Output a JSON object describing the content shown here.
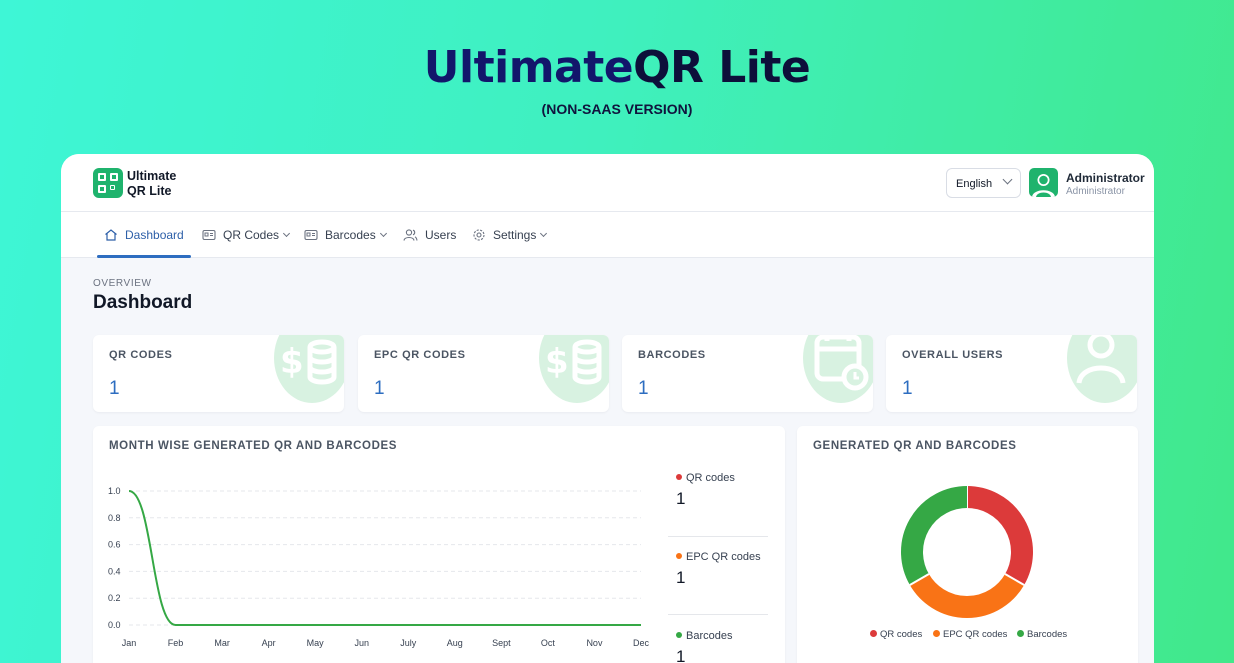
{
  "hero": {
    "title_part1": "Ultimate",
    "title_part2": "QR Lite",
    "subtitle": "(NON-SAAS VERSION)"
  },
  "app": {
    "logo": {
      "line1": "Ultimate",
      "line2": "QR Lite"
    },
    "language": {
      "selected": "English"
    },
    "user": {
      "name": "Administrator",
      "role": "Administrator"
    },
    "nav": [
      {
        "label": "Dashboard",
        "icon": "home-icon",
        "active": true
      },
      {
        "label": "QR Codes",
        "icon": "qr-card-icon",
        "dropdown": true
      },
      {
        "label": "Barcodes",
        "icon": "barcode-card-icon",
        "dropdown": true
      },
      {
        "label": "Users",
        "icon": "users-icon"
      },
      {
        "label": "Settings",
        "icon": "gear-icon",
        "dropdown": true
      }
    ],
    "overview_label": "OVERVIEW",
    "page_title": "Dashboard",
    "stats": [
      {
        "label": "QR CODES",
        "value": "1",
        "icon": "money-stack-icon"
      },
      {
        "label": "EPC QR CODES",
        "value": "1",
        "icon": "money-stack-icon"
      },
      {
        "label": "BARCODES",
        "value": "1",
        "icon": "calendar-clock-icon"
      },
      {
        "label": "OVERALL USERS",
        "value": "1",
        "icon": "user-icon"
      }
    ],
    "line_panel": {
      "title": "MONTH WISE GENERATED QR AND BARCODES",
      "legend": [
        {
          "label": "QR codes",
          "value": "1",
          "color": "#dc3a3a"
        },
        {
          "label": "EPC QR codes",
          "value": "1",
          "color": "#f97316"
        },
        {
          "label": "Barcodes",
          "value": "1",
          "color": "#35a845"
        }
      ]
    },
    "donut_panel": {
      "title": "GENERATED QR AND BARCODES"
    }
  },
  "chart_data": [
    {
      "type": "line",
      "x": [
        "Jan",
        "Feb",
        "Mar",
        "Apr",
        "May",
        "Jun",
        "July",
        "Aug",
        "Sept",
        "Oct",
        "Nov",
        "Dec"
      ],
      "yticks": [
        "1.0",
        "0.8",
        "0.6",
        "0.4",
        "0.2",
        "0.0"
      ],
      "ylim": [
        0,
        1
      ],
      "grid": true,
      "series": [
        {
          "name": "Barcodes",
          "color": "#35a845",
          "values": [
            1,
            0,
            0,
            0,
            0,
            0,
            0,
            0,
            0,
            0,
            0,
            0
          ]
        }
      ]
    },
    {
      "type": "pie",
      "categories": [
        "QR codes",
        "EPC QR codes",
        "Barcodes"
      ],
      "values": [
        1,
        1,
        1
      ],
      "colors": [
        "#dc3a3a",
        "#f97316",
        "#35a845"
      ],
      "legend": "bottom"
    }
  ]
}
